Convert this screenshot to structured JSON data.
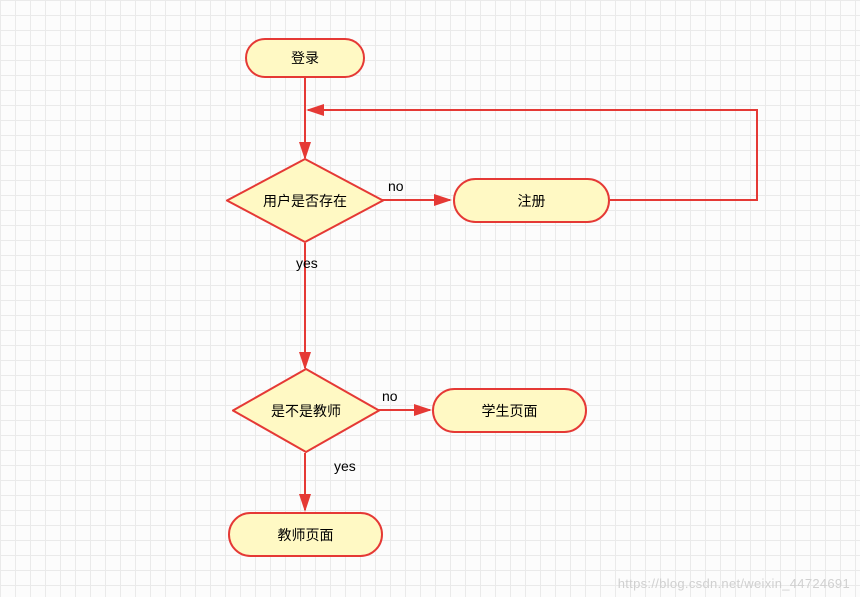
{
  "nodes": {
    "login": {
      "label": "登录"
    },
    "user_exists": {
      "label": "用户是否存在"
    },
    "register": {
      "label": "注册"
    },
    "is_teacher": {
      "label": "是不是教师"
    },
    "student_page": {
      "label": "学生页面"
    },
    "teacher_page": {
      "label": "教师页面"
    }
  },
  "edges": {
    "user_exists_no": "no",
    "user_exists_yes": "yes",
    "is_teacher_no": "no",
    "is_teacher_yes": "yes"
  },
  "watermark": "https://blog.csdn.net/weixin_44724691"
}
